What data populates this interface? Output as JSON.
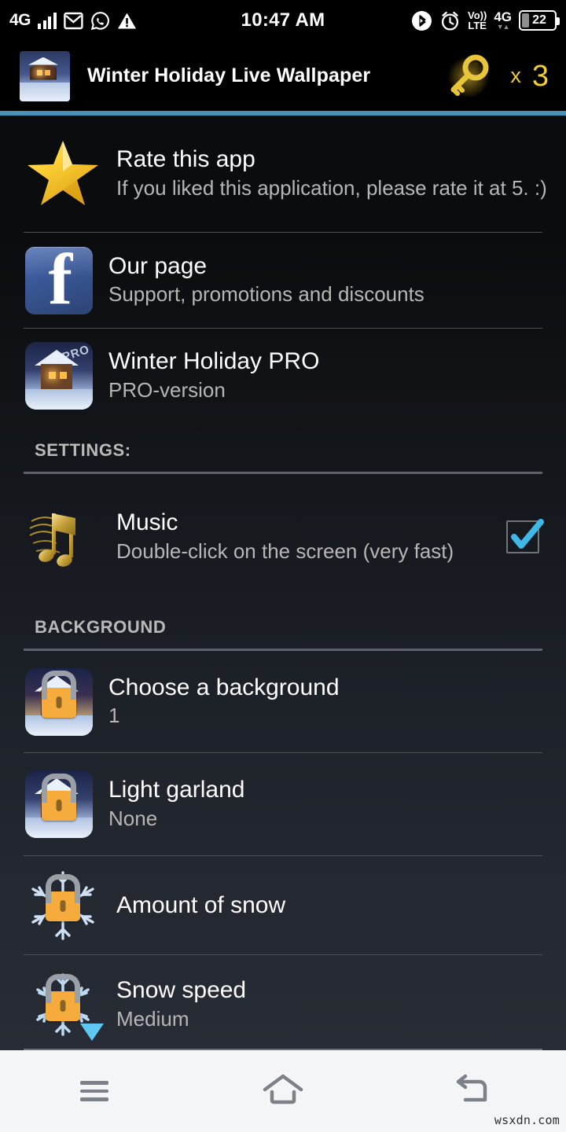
{
  "status_bar": {
    "network_label": "4G",
    "signal_icon": "signal-bars-icon",
    "mail_icon": "mail-icon",
    "whatsapp_icon": "whatsapp-icon",
    "warning_icon": "warning-triangle-icon",
    "clock": "10:47 AM",
    "bluetooth_icon": "bluetooth-icon",
    "alarm_icon": "alarm-clock-icon",
    "volte_top": "Vo))",
    "volte_bottom": "LTE",
    "data_network": "4G",
    "data_arrows": "▼▲",
    "battery_percent": "22"
  },
  "app_bar": {
    "app_icon": "winter-cabin-app-icon",
    "title": "Winter Holiday Live Wallpaper",
    "key_icon": "golden-key-icon",
    "multiplier": "x",
    "key_count": "3",
    "accent_color": "#4a90b8"
  },
  "list": {
    "items": [
      {
        "id": "rate-this-app",
        "icon": "gold-star-icon",
        "title": "Rate this app",
        "subtitle": "If you liked this application, please rate it at 5. :)"
      },
      {
        "id": "our-page",
        "icon": "facebook-icon",
        "title": "Our page",
        "subtitle": "Support, promotions and discounts"
      },
      {
        "id": "winter-holiday-pro",
        "icon": "winter-holiday-pro-icon",
        "title": "Winter Holiday PRO",
        "subtitle": "PRO-version",
        "badge": "PRO"
      }
    ]
  },
  "settings_section": {
    "header": "SETTINGS:",
    "items": [
      {
        "id": "music",
        "icon": "music-notes-icon",
        "title": "Music",
        "subtitle": "Double-click on the screen (very fast)",
        "control": "checkbox",
        "checked": true,
        "check_color": "#3fb8e8"
      }
    ]
  },
  "background_section": {
    "header": "BACKGROUND",
    "items": [
      {
        "id": "choose-a-background",
        "icon": "locked-cabin-icon",
        "title": "Choose a background",
        "subtitle": "1",
        "locked": true
      },
      {
        "id": "light-garland",
        "icon": "locked-garland-cabin-icon",
        "title": "Light garland",
        "subtitle": "None",
        "locked": true
      },
      {
        "id": "amount-of-snow",
        "icon": "locked-snowflake-icon",
        "title": "Amount of snow",
        "subtitle": "",
        "locked": true
      },
      {
        "id": "snow-speed",
        "icon": "locked-snowflake-icon",
        "title": "Snow speed",
        "subtitle": "Medium",
        "locked": true,
        "marker": "blue-triangle-down"
      }
    ]
  },
  "nav_bar": {
    "menu_icon": "menu-hamburger-icon",
    "home_icon": "home-icon",
    "back_icon": "back-arrow-icon"
  },
  "watermark": "wsxdn.com"
}
